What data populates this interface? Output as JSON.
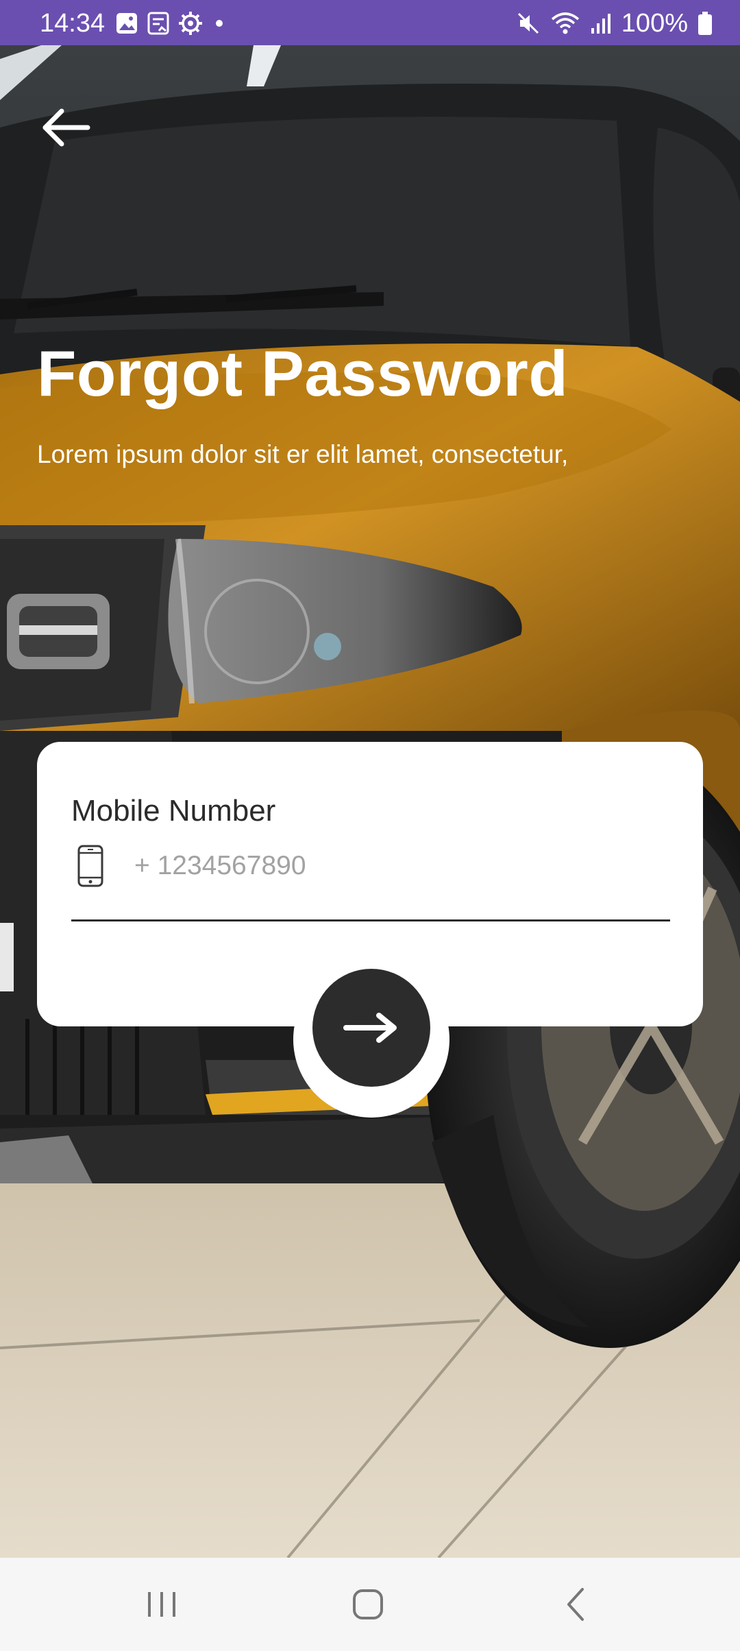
{
  "status_bar": {
    "time": "14:34",
    "battery": "100%",
    "left_icons": [
      "gallery-icon",
      "note-icon",
      "settings-icon",
      "dot-icon"
    ],
    "right_icons": [
      "mute-icon",
      "wifi-icon",
      "signal-icon",
      "battery-icon"
    ]
  },
  "header": {
    "back_icon": "arrow-left-icon",
    "title": "Forgot Password",
    "subtitle": "Lorem ipsum dolor sit er elit lamet, consectetur,"
  },
  "form": {
    "mobile_label": "Mobile Number",
    "mobile_placeholder": "+ 1234567890",
    "mobile_value": "",
    "mobile_icon": "smartphone-icon",
    "submit_icon": "arrow-right-icon"
  },
  "nav_bar": {
    "buttons": [
      "recents-icon",
      "home-icon",
      "back-icon"
    ]
  },
  "colors": {
    "status_bar": "#6a4fb0",
    "card": "#ffffff",
    "submit_button": "#2c2c2c",
    "car_body": "#c9881c"
  }
}
